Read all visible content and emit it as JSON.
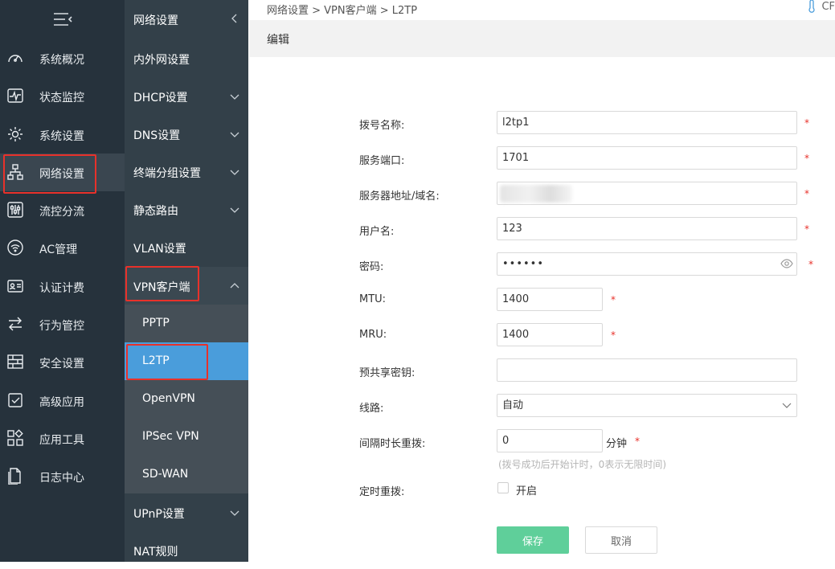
{
  "colors": {
    "sidebar": "#26323c",
    "sidebar2": "#334049",
    "accent": "#4a9ddb",
    "highlight": "#e8312a",
    "save": "#5fcf9a"
  },
  "sidebar": {
    "toggle_icon": "menu-collapse-icon",
    "items": [
      {
        "label": "系统概况",
        "icon": "dashboard-icon"
      },
      {
        "label": "状态监控",
        "icon": "monitor-icon"
      },
      {
        "label": "系统设置",
        "icon": "gear-icon"
      },
      {
        "label": "网络设置",
        "icon": "network-icon"
      },
      {
        "label": "流控分流",
        "icon": "sliders-icon"
      },
      {
        "label": "AC管理",
        "icon": "wifi-ac-icon"
      },
      {
        "label": "认证计费",
        "icon": "id-card-icon"
      },
      {
        "label": "行为管控",
        "icon": "arrows-icon"
      },
      {
        "label": "安全设置",
        "icon": "firewall-icon"
      },
      {
        "label": "高级应用",
        "icon": "checklist-icon"
      },
      {
        "label": "应用工具",
        "icon": "apps-icon"
      },
      {
        "label": "日志中心",
        "icon": "document-icon"
      }
    ]
  },
  "subnav": {
    "title": "网络设置",
    "items": [
      {
        "label": "内外网设置"
      },
      {
        "label": "DHCP设置"
      },
      {
        "label": "DNS设置"
      },
      {
        "label": "终端分组设置"
      },
      {
        "label": "静态路由"
      },
      {
        "label": "VLAN设置"
      },
      {
        "label": "VPN客户端"
      },
      {
        "label": "PPTP"
      },
      {
        "label": "L2TP"
      },
      {
        "label": "OpenVPN"
      },
      {
        "label": "IPSec VPN"
      },
      {
        "label": "SD-WAN"
      },
      {
        "label": "UPnP设置"
      },
      {
        "label": "NAT规则"
      }
    ]
  },
  "breadcrumb": "网络设置 > VPN客户端 > L2TP",
  "topright": {
    "text": "CF",
    "icon": "thermometer-icon"
  },
  "panel_title": "编辑",
  "form": {
    "dial_name": {
      "label": "拨号名称:",
      "value": "l2tp1"
    },
    "server_port": {
      "label": "服务端口:",
      "value": "1701"
    },
    "server_addr": {
      "label": "服务器地址/域名:",
      "value": ""
    },
    "username": {
      "label": "用户名:",
      "value": "123"
    },
    "password": {
      "label": "密码:",
      "value": "••••••"
    },
    "mtu": {
      "label": "MTU:",
      "value": "1400"
    },
    "mru": {
      "label": "MRU:",
      "value": "1400"
    },
    "psk": {
      "label": "预共享密钥:",
      "value": ""
    },
    "line": {
      "label": "线路:",
      "value": "自动"
    },
    "redial_interval": {
      "label": "间隔时长重拨:",
      "value": "0",
      "unit": "分钟",
      "hint": "(拨号成功后开始计时，0表示无限时间)"
    },
    "scheduled_redial": {
      "label": "定时重拨:",
      "checkbox_label": "开启",
      "checked": false
    },
    "required_mark": "*"
  },
  "buttons": {
    "save": "保存",
    "cancel": "取消"
  }
}
